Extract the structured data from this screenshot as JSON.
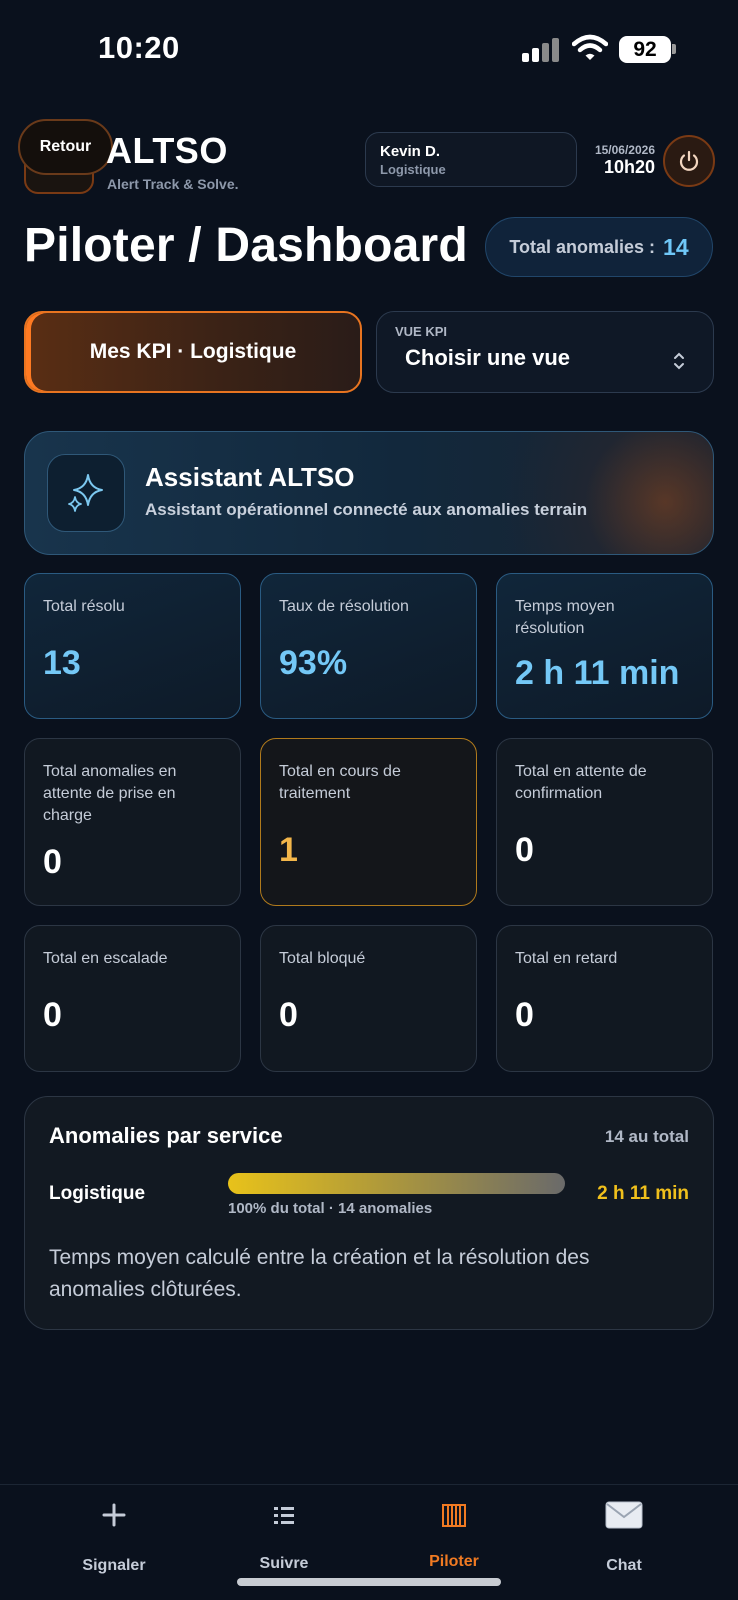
{
  "status_bar": {
    "time": "10:20",
    "battery": "92"
  },
  "header": {
    "back_label": "Retour",
    "brand": "ALTSO",
    "tagline": "Alert Track & Solve.",
    "user_name": "Kevin D.",
    "user_role": "Logistique",
    "date": "15/06/2026",
    "time": "10h20"
  },
  "title_row": {
    "title": "Piloter / Dashboard",
    "total_label": "Total anomalies :",
    "total_value": "14"
  },
  "kpi": {
    "my_kpi_label": "Mes KPI · Logistique",
    "view_label": "VUE KPI",
    "view_value": "Choisir une vue"
  },
  "assistant": {
    "title": "Assistant ALTSO",
    "subtitle": "Assistant opérationnel connecté aux anomalies terrain"
  },
  "stats": [
    {
      "label": "Total résolu",
      "value": "13"
    },
    {
      "label": "Taux de résolution",
      "value": "93%"
    },
    {
      "label": "Temps moyen résolution",
      "value": "2 h 11 min"
    },
    {
      "label": "Total anomalies en attente de prise en charge",
      "value": "0"
    },
    {
      "label": "Total en cours de traitement",
      "value": "1"
    },
    {
      "label": "Total en attente de confirmation",
      "value": "0"
    },
    {
      "label": "Total en escalade",
      "value": "0"
    },
    {
      "label": "Total bloqué",
      "value": "0"
    },
    {
      "label": "Total en retard",
      "value": "0"
    }
  ],
  "service_panel": {
    "title": "Anomalies par service",
    "total": "14 au total",
    "rows": [
      {
        "name": "Logistique",
        "detail": "100% du total · 14 anomalies",
        "time": "2 h 11 min",
        "share": 1.0
      }
    ],
    "note": "Temps moyen calculé entre la création et la résolution des anomalies clôturées."
  },
  "nav": [
    {
      "label": "Signaler",
      "icon": "plus-icon"
    },
    {
      "label": "Suivre",
      "icon": "list-icon"
    },
    {
      "label": "Piloter",
      "icon": "chart-icon",
      "active": true
    },
    {
      "label": "Chat",
      "icon": "envelope-icon"
    }
  ],
  "colors": {
    "accent_orange": "#f07a22",
    "accent_blue": "#74c8f6",
    "accent_amber": "#f3b64a",
    "accent_yellow": "#f0c01c",
    "background": "#0a111d"
  }
}
